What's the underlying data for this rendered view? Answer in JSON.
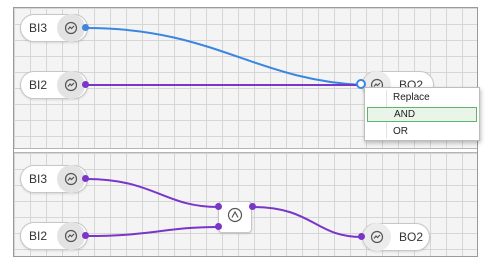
{
  "top_panel": {
    "nodes": [
      {
        "label": "BI3",
        "icon": "gauge-icon"
      },
      {
        "label": "BI2",
        "icon": "gauge-icon"
      }
    ],
    "output": {
      "label": "BO2",
      "icon": "gauge-icon"
    }
  },
  "context_menu": {
    "items": [
      "Replace",
      "AND",
      "OR"
    ],
    "selected": "AND"
  },
  "bottom_panel": {
    "nodes": [
      {
        "label": "BI3",
        "icon": "gauge-icon"
      },
      {
        "label": "BI2",
        "icon": "gauge-icon"
      }
    ],
    "gate_icon": "and-gate-icon",
    "output": {
      "label": "BO2",
      "icon": "gauge-icon"
    }
  },
  "colors": {
    "wire_blue": "#3a86e0",
    "wire_purple": "#7a35c9",
    "menu_highlight_border": "#5fb36c"
  }
}
